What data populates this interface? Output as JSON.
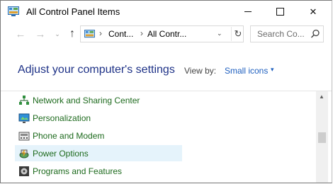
{
  "window": {
    "title": "All Control Panel Items",
    "controls": {
      "minimize": "minimize",
      "maximize": "maximize",
      "close": "✕"
    }
  },
  "address": {
    "crumbs": [
      "Cont...",
      "All Contr..."
    ],
    "separator": "›",
    "dropdown": "⌄",
    "refresh": "↻"
  },
  "nav": {
    "back": "←",
    "forward": "→",
    "recent": "⌄",
    "up": "↑"
  },
  "search": {
    "placeholder": "Search Co..."
  },
  "header": {
    "title": "Adjust your computer's settings",
    "view_by_label": "View by:",
    "view_by_value": "Small icons",
    "view_by_arrow": "▾"
  },
  "items": [
    {
      "label": "Network and Sharing Center",
      "icon": "network-icon"
    },
    {
      "label": "Personalization",
      "icon": "personalization-icon"
    },
    {
      "label": "Phone and Modem",
      "icon": "phone-modem-icon"
    },
    {
      "label": "Power Options",
      "icon": "power-options-icon",
      "highlighted": true
    },
    {
      "label": "Programs and Features",
      "icon": "programs-features-icon"
    }
  ],
  "colors": {
    "heading": "#1e3287",
    "link": "#1e5fbf",
    "item_text": "#1d6a1d",
    "highlight": "#e5f3fb"
  }
}
